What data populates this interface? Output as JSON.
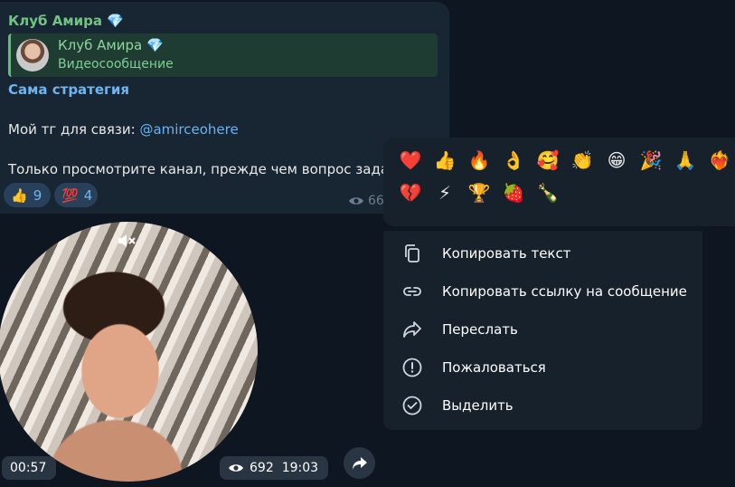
{
  "post": {
    "channel": "Клуб Амира",
    "gem": "💎",
    "reply": {
      "name": "Клуб Амира",
      "gem": "💎",
      "subtitle": "Видеосообщение"
    },
    "heading": "Сама стратегия",
    "line2_prefix": "Мой тг для связи: ",
    "line2_link": "@amirceohere",
    "line3": "Только просмотрите канал, прежде чем вопрос задав",
    "reactions": [
      {
        "emoji": "👍",
        "count": "9"
      },
      {
        "emoji": "💯",
        "count": "4"
      }
    ],
    "views": "66"
  },
  "video": {
    "duration": "00:57",
    "views": "692",
    "time": "19:03"
  },
  "reaction_bar": {
    "row1": [
      "❤️",
      "👍",
      "🔥",
      "👌",
      "🥰",
      "👏",
      "😁",
      "🎉",
      "🙏",
      "❤️‍🔥"
    ],
    "row2": [
      "💔",
      "⚡",
      "🏆",
      "🍓",
      "🍾"
    ]
  },
  "menu": {
    "items": [
      {
        "label": "Копировать текст",
        "icon": "copy-icon"
      },
      {
        "label": "Копировать ссылку на сообщение",
        "icon": "link-icon"
      },
      {
        "label": "Переслать",
        "icon": "forward-icon"
      },
      {
        "label": "Пожаловаться",
        "icon": "report-icon"
      },
      {
        "label": "Выделить",
        "icon": "select-icon"
      }
    ]
  }
}
